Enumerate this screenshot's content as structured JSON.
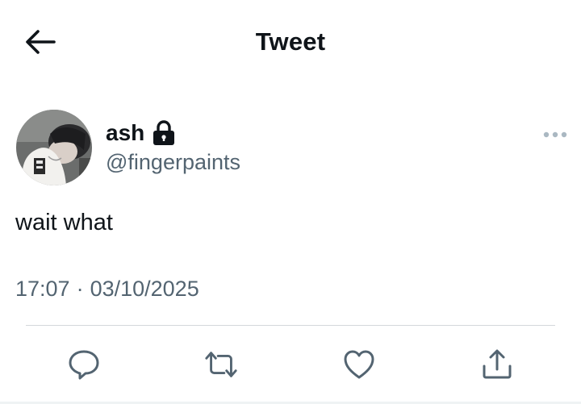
{
  "header": {
    "title": "Tweet",
    "back_icon": "arrow-left-icon"
  },
  "tweet": {
    "author": {
      "display_name": "ash",
      "handle": "@fingerpaints",
      "protected_icon": "lock-icon",
      "avatar": "avatar-photo"
    },
    "text": "wait what",
    "time": "17:07",
    "separator": "·",
    "date": "03/10/2025",
    "more_icon": "more-horizontal-icon"
  },
  "actions": [
    {
      "name": "reply",
      "icon": "reply-icon"
    },
    {
      "name": "retweet",
      "icon": "retweet-icon"
    },
    {
      "name": "like",
      "icon": "heart-icon"
    },
    {
      "name": "share",
      "icon": "share-icon"
    }
  ],
  "colors": {
    "text_primary": "#0f1419",
    "text_secondary": "#536471",
    "divider": "#d4d8db"
  }
}
